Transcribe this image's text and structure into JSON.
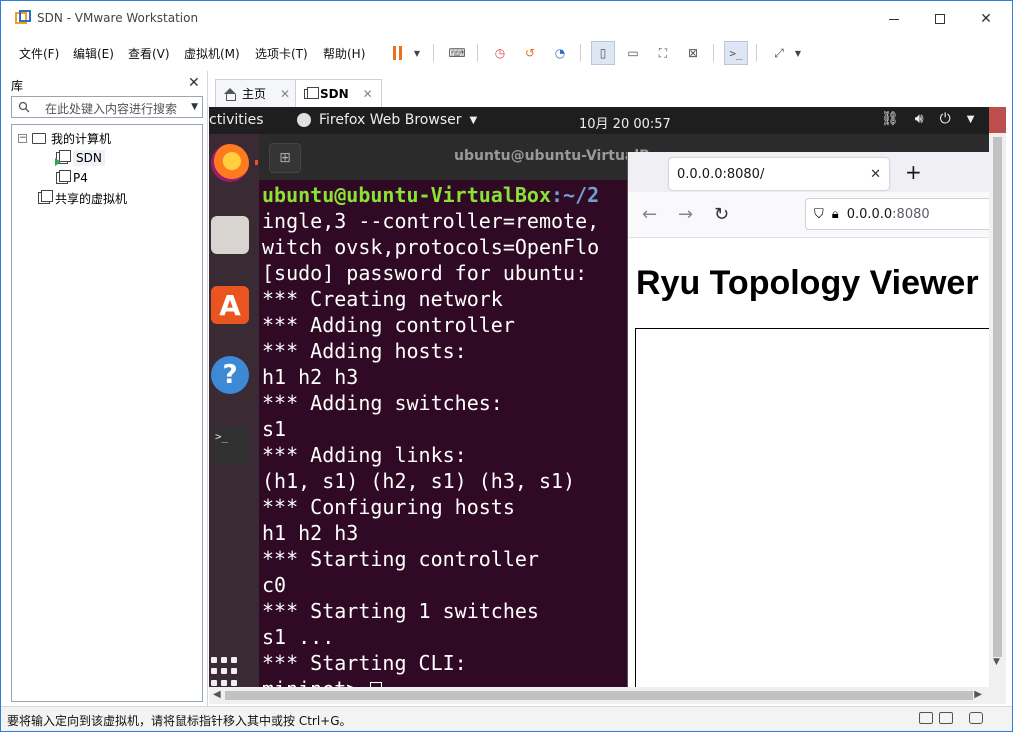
{
  "window": {
    "title": "SDN - VMware Workstation"
  },
  "menu": [
    "文件(F)",
    "编辑(E)",
    "查看(V)",
    "虚拟机(M)",
    "选项卡(T)",
    "帮助(H)"
  ],
  "library": {
    "title": "库",
    "search_placeholder": "在此处键入内容进行搜索",
    "tree": {
      "root": "我的计算机",
      "vms": [
        "SDN",
        "P4"
      ],
      "shared": "共享的虚拟机"
    }
  },
  "tabs": [
    {
      "label": "主页"
    },
    {
      "label": "SDN"
    }
  ],
  "guest": {
    "topbar": {
      "activities": "ctivities",
      "app": "Firefox Web Browser",
      "clock": "10月 20  00:57"
    },
    "terminal": {
      "title": "ubuntu@ubuntu-VirtualB",
      "prompt_user": "ubuntu@ubuntu-VirtualBox",
      "prompt_path": ":~/2",
      "lines": [
        "ingle,3 --controller=remote,",
        "witch ovsk,protocols=OpenFlo",
        "[sudo] password for ubuntu:",
        "*** Creating network",
        "*** Adding controller",
        "*** Adding hosts:",
        "h1 h2 h3",
        "*** Adding switches:",
        "s1",
        "*** Adding links:",
        "(h1, s1) (h2, s1) (h3, s1)",
        "*** Configuring hosts",
        "h1 h2 h3",
        "*** Starting controller",
        "c0",
        "*** Starting 1 switches",
        "s1 ...",
        "*** Starting CLI:"
      ],
      "last_prompt": "mininet>"
    },
    "firefox": {
      "tab_title": "0.0.0.0:8080/",
      "url_host": "0.0.0.0",
      "url_port": ":8080",
      "page_heading": "Ryu Topology Viewer"
    }
  },
  "status": {
    "text": "要将输入定向到该虚拟机，请将鼠标指针移入其中或按 Ctrl+G。"
  },
  "colors": {
    "accent": "#2b7fd8",
    "terminal_bg": "#300a24",
    "prompt_user": "#8ae234",
    "prompt_path": "#729fcf",
    "pause": "#e8731c"
  }
}
